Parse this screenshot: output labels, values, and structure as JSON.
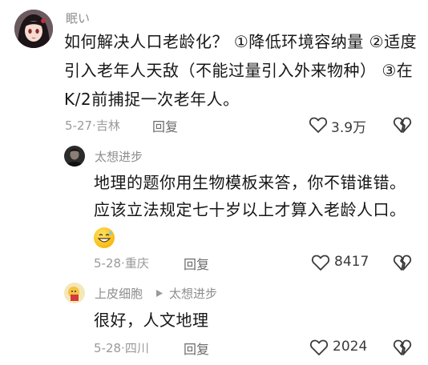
{
  "comments": [
    {
      "username": "眠い",
      "lines": [
        "如何解决人口老龄化？ ①降低环境容纳量 ②适度",
        "引入老年人天敌（不能过量引入外来物种） ③在",
        "K/2前捕捉一次老年人。"
      ],
      "date": "5-27·",
      "location": "吉林",
      "reply_label": "回复",
      "likes": "3.9万",
      "avatar": "anime-girl-avatar"
    },
    {
      "username": "太想进步",
      "lines": [
        "地理的题你用生物模板来答，你不错谁错。",
        "应该立法规定七十岁以上才算入老龄人口。"
      ],
      "emoji": "grinning-sweat-emoji",
      "date": "5-28·",
      "location": "重庆",
      "reply_label": "回复",
      "likes": "8417",
      "avatar": "dark-portrait-avatar"
    },
    {
      "username": "上皮细胞",
      "reply_to": "太想进步",
      "lines": [
        "很好，人文地理"
      ],
      "date": "5-28·",
      "location": "四川",
      "reply_label": "回复",
      "likes": "2024",
      "avatar": "cartoon-avatar"
    }
  ],
  "colors": {
    "name": "#8d8d8d",
    "meta": "#9a9a9a",
    "text": "#161616"
  }
}
